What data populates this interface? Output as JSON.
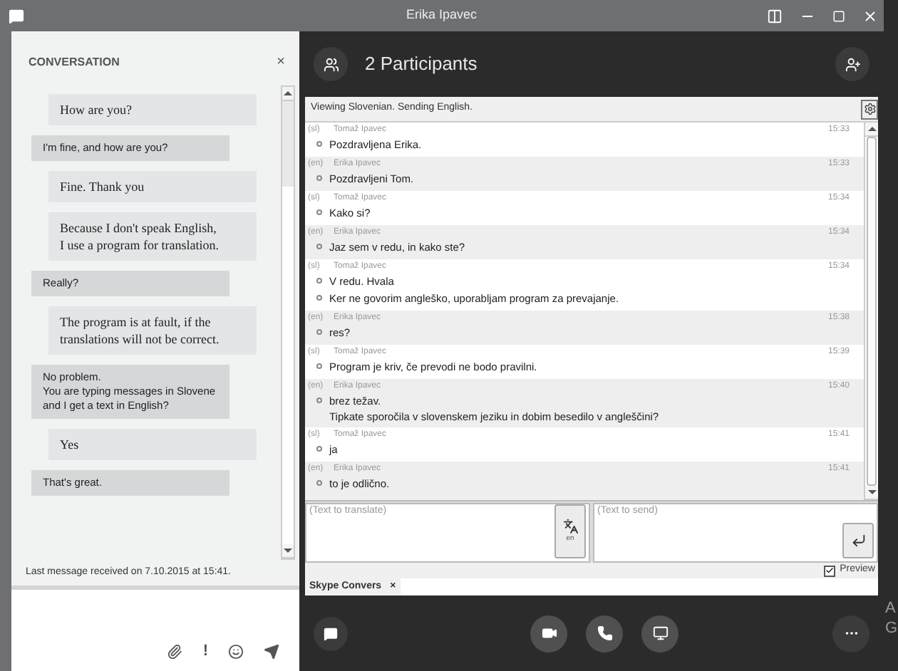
{
  "window": {
    "title": "Erika Ipavec"
  },
  "conversation": {
    "title": "CONVERSATION",
    "close": "×",
    "messages": [
      {
        "kind": "sent",
        "text": "How are you?"
      },
      {
        "kind": "received",
        "text": "I'm fine,  and how are you?"
      },
      {
        "kind": "sent",
        "text": "Fine. Thank you"
      },
      {
        "kind": "sent",
        "text": "Because I don't speak English,\nI use a program for translation."
      },
      {
        "kind": "received",
        "text": "Really?"
      },
      {
        "kind": "sent",
        "text": "The program is at fault, if the translations will not be correct."
      },
      {
        "kind": "received",
        "text": "No problem.\nYou are typing messages in Slovene and I get a text in English?"
      },
      {
        "kind": "sent",
        "text": "Yes"
      },
      {
        "kind": "received",
        "text": "That's great."
      }
    ],
    "status": "Last message received on 7.10.2015 at 15:41.",
    "compose_toolbar": [
      "!"
    ]
  },
  "call": {
    "participants": "2 Participants"
  },
  "translator": {
    "status": "Viewing Slovenian. Sending English.",
    "entries": [
      {
        "lang": "(sl)",
        "author": "Tomaž Ipavec",
        "time": "15:33",
        "lines": [
          "Pozdravljena Erika."
        ]
      },
      {
        "lang": "(en)",
        "author": "Erika Ipavec",
        "time": "15:33",
        "lines": [
          "Pozdravljeni Tom."
        ]
      },
      {
        "lang": "(sl)",
        "author": "Tomaž Ipavec",
        "time": "15:34",
        "lines": [
          "Kako si?"
        ]
      },
      {
        "lang": "(en)",
        "author": "Erika Ipavec",
        "time": "15:34",
        "lines": [
          "Jaz sem v redu, in kako ste?"
        ]
      },
      {
        "lang": "(sl)",
        "author": "Tomaž Ipavec",
        "time": "15:34",
        "lines": [
          "V redu. Hvala",
          "Ker ne govorim angleško, uporabljam program za prevajanje."
        ]
      },
      {
        "lang": "(en)",
        "author": "Erika Ipavec",
        "time": "15:38",
        "lines": [
          "res?"
        ]
      },
      {
        "lang": "(sl)",
        "author": "Tomaž Ipavec",
        "time": "15:39",
        "lines": [
          "Program je kriv, če prevodi ne bodo pravilni."
        ]
      },
      {
        "lang": "(en)",
        "author": "Erika Ipavec",
        "time": "15:40",
        "lines": [
          "brez težav.\nTipkate sporočila v slovenskem jeziku in dobim besedilo v angleščini?"
        ]
      },
      {
        "lang": "(sl)",
        "author": "Tomaž Ipavec",
        "time": "15:41",
        "lines": [
          "ja"
        ]
      },
      {
        "lang": "(en)",
        "author": "Erika Ipavec",
        "time": "15:41",
        "lines": [
          "to je odlično."
        ]
      }
    ],
    "translate_input": {
      "placeholder": "(Text to translate)"
    },
    "translate_button": {
      "label": "en"
    },
    "send_input": {
      "placeholder": "(Text to send)"
    },
    "preview": {
      "label": "Preview",
      "checked": true
    },
    "tab": {
      "label": "Skype Convers",
      "close": "×"
    }
  },
  "edge_text": [
    "A",
    "G"
  ]
}
